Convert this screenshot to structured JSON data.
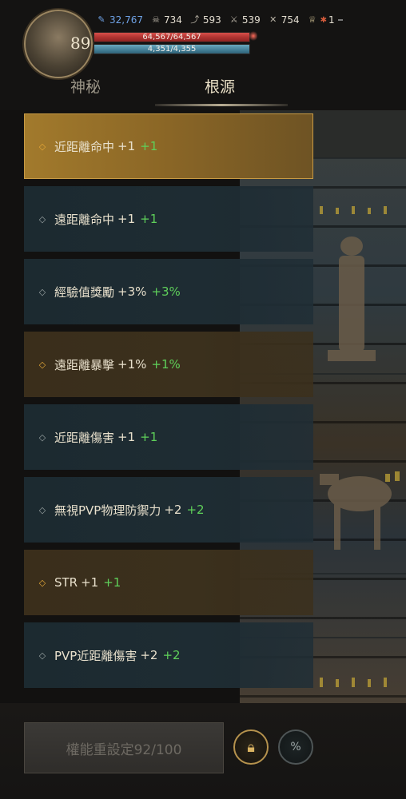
{
  "header": {
    "level": "89",
    "stats": [
      {
        "icon": "feather-icon",
        "value": "32,767"
      },
      {
        "icon": "skull-icon",
        "value": "734"
      },
      {
        "icon": "wing-icon",
        "value": "593"
      },
      {
        "icon": "sword-icon",
        "value": "539"
      },
      {
        "icon": "crossed-weapons-icon",
        "value": "754"
      },
      {
        "icon": "trophy-icon",
        "value": "1"
      }
    ],
    "hp": {
      "text": "64,567/64,567",
      "fraction": 1.0
    },
    "mp": {
      "text": "4,351/4,355",
      "fraction": 0.999
    }
  },
  "tabs": [
    {
      "label": "神秘",
      "active": false
    },
    {
      "label": "根源",
      "active": true
    }
  ],
  "rows": [
    {
      "name": "近距離命中",
      "value": "+1",
      "bonus": "+1",
      "style": "gold",
      "active": true
    },
    {
      "name": "遠距離命中",
      "value": "+1",
      "bonus": "+1",
      "style": "teal",
      "active": false
    },
    {
      "name": "經驗值獎勵",
      "value": "+3%",
      "bonus": "+3%",
      "style": "teal",
      "active": false
    },
    {
      "name": "遠距離暴擊",
      "value": "+1%",
      "bonus": "+1%",
      "style": "gold",
      "active": false
    },
    {
      "name": "近距離傷害",
      "value": "+1",
      "bonus": "+1",
      "style": "teal",
      "active": false
    },
    {
      "name": "無視PVP物理防禦力",
      "value": "+2",
      "bonus": "+2",
      "style": "teal",
      "active": false
    },
    {
      "name": "STR",
      "value": "+1",
      "bonus": "+1",
      "style": "gold",
      "active": false
    },
    {
      "name": "PVP近距離傷害",
      "value": "+2",
      "bonus": "+2",
      "style": "teal",
      "active": false
    }
  ],
  "bottom": {
    "reset_label": "權能重設定92/100",
    "lock_icon": "lock-icon",
    "percent_icon": "percent-icon"
  },
  "colors": {
    "gold_row": "#3b301d",
    "gold_active": "#a27a2c",
    "teal_row": "#1e2c33",
    "bonus_green": "#5fd05a",
    "hp_red": "#b03431",
    "mp_blue": "#437f97"
  }
}
